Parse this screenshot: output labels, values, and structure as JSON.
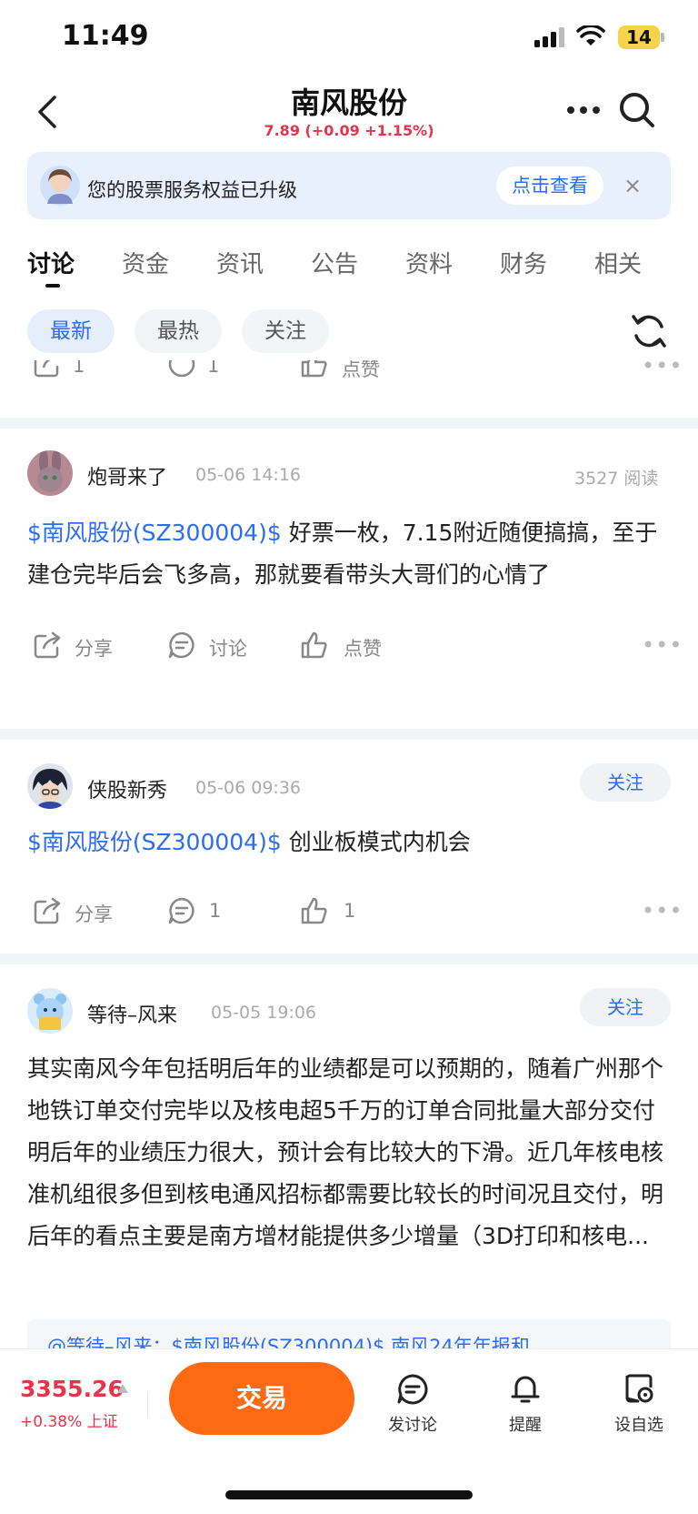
{
  "status": {
    "time": "11:49",
    "battery": "14"
  },
  "nav": {
    "title": "南风股份",
    "quote": "7.89 (+0.09 +1.15%)"
  },
  "banner": {
    "text": "您的股票服务权益已升级",
    "button": "点击查看",
    "close": "×"
  },
  "tabs": [
    "讨论",
    "资金",
    "资讯",
    "公告",
    "资料",
    "财务",
    "相关"
  ],
  "filters": [
    "最新",
    "最热",
    "关注"
  ],
  "partial_post": {
    "share_count": "1",
    "comment_count": "1",
    "like_label": "点赞"
  },
  "posts": [
    {
      "user": "炮哥来了",
      "time": "05-06 14:16",
      "reads": "3527 阅读",
      "stock": "$南风股份(SZ300004)$",
      "text": " 好票一枚，7.15附近随便搞搞，至于建仓完毕后会飞多高，那就要看带头大哥们的心情了",
      "share": "分享",
      "comment": "讨论",
      "like": "点赞"
    },
    {
      "user": "侠股新秀",
      "time": "05-06 09:36",
      "follow": "关注",
      "stock": "$南风股份(SZ300004)$",
      "text": " 创业板模式内机会",
      "share": "分享",
      "comment": "1",
      "like": "1"
    },
    {
      "user": "等待–风来",
      "time": "05-05 19:06",
      "follow": "关注",
      "text": "其实南风今年包括明后年的业绩都是可以预期的，随着广州那个地铁订单交付完毕以及核电超5千万的订单合同批量大部分交付明后年的业绩压力很大，预计会有比较大的下滑。近几年核电核准机组很多但到核电通风招标都需要比较长的时间况且交付，明后年的看点主要是南方增材能提供多少增量（3D打印和核电...",
      "quote": "@等待–风来：$南风股份(SZ300004)$ 南风24年年报和"
    }
  ],
  "bottom": {
    "index_value": "3355.26",
    "index_change": "+0.38%",
    "index_name": "上证",
    "trade": "交易",
    "items": [
      "发讨论",
      "提醒",
      "设自选"
    ]
  },
  "colors": {
    "accent": "#2c6df0",
    "up": "#e8334a",
    "trade": "#ff6a13"
  }
}
